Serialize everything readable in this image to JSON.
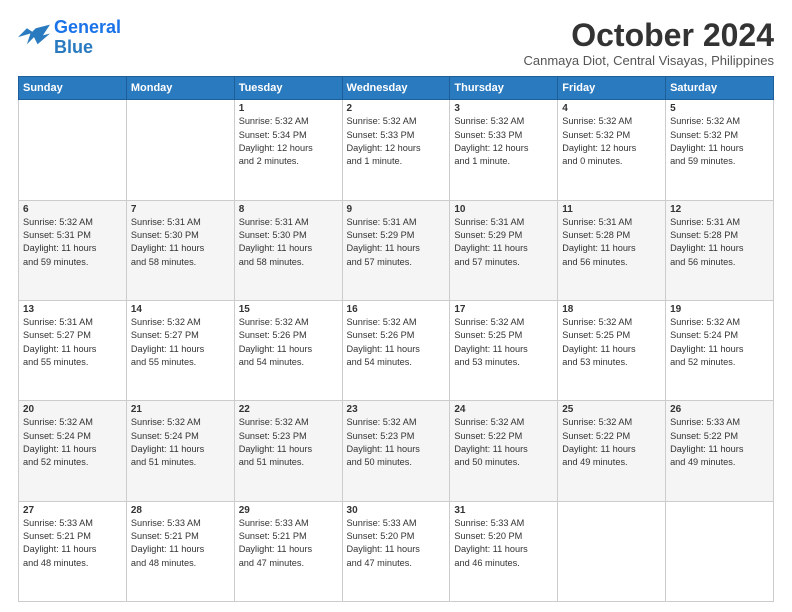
{
  "logo": {
    "line1": "General",
    "line2": "Blue"
  },
  "title": "October 2024",
  "subtitle": "Canmaya Diot, Central Visayas, Philippines",
  "headers": [
    "Sunday",
    "Monday",
    "Tuesday",
    "Wednesday",
    "Thursday",
    "Friday",
    "Saturday"
  ],
  "weeks": [
    [
      {
        "day": "",
        "info": ""
      },
      {
        "day": "",
        "info": ""
      },
      {
        "day": "1",
        "info": "Sunrise: 5:32 AM\nSunset: 5:34 PM\nDaylight: 12 hours\nand 2 minutes."
      },
      {
        "day": "2",
        "info": "Sunrise: 5:32 AM\nSunset: 5:33 PM\nDaylight: 12 hours\nand 1 minute."
      },
      {
        "day": "3",
        "info": "Sunrise: 5:32 AM\nSunset: 5:33 PM\nDaylight: 12 hours\nand 1 minute."
      },
      {
        "day": "4",
        "info": "Sunrise: 5:32 AM\nSunset: 5:32 PM\nDaylight: 12 hours\nand 0 minutes."
      },
      {
        "day": "5",
        "info": "Sunrise: 5:32 AM\nSunset: 5:32 PM\nDaylight: 11 hours\nand 59 minutes."
      }
    ],
    [
      {
        "day": "6",
        "info": "Sunrise: 5:32 AM\nSunset: 5:31 PM\nDaylight: 11 hours\nand 59 minutes."
      },
      {
        "day": "7",
        "info": "Sunrise: 5:31 AM\nSunset: 5:30 PM\nDaylight: 11 hours\nand 58 minutes."
      },
      {
        "day": "8",
        "info": "Sunrise: 5:31 AM\nSunset: 5:30 PM\nDaylight: 11 hours\nand 58 minutes."
      },
      {
        "day": "9",
        "info": "Sunrise: 5:31 AM\nSunset: 5:29 PM\nDaylight: 11 hours\nand 57 minutes."
      },
      {
        "day": "10",
        "info": "Sunrise: 5:31 AM\nSunset: 5:29 PM\nDaylight: 11 hours\nand 57 minutes."
      },
      {
        "day": "11",
        "info": "Sunrise: 5:31 AM\nSunset: 5:28 PM\nDaylight: 11 hours\nand 56 minutes."
      },
      {
        "day": "12",
        "info": "Sunrise: 5:31 AM\nSunset: 5:28 PM\nDaylight: 11 hours\nand 56 minutes."
      }
    ],
    [
      {
        "day": "13",
        "info": "Sunrise: 5:31 AM\nSunset: 5:27 PM\nDaylight: 11 hours\nand 55 minutes."
      },
      {
        "day": "14",
        "info": "Sunrise: 5:32 AM\nSunset: 5:27 PM\nDaylight: 11 hours\nand 55 minutes."
      },
      {
        "day": "15",
        "info": "Sunrise: 5:32 AM\nSunset: 5:26 PM\nDaylight: 11 hours\nand 54 minutes."
      },
      {
        "day": "16",
        "info": "Sunrise: 5:32 AM\nSunset: 5:26 PM\nDaylight: 11 hours\nand 54 minutes."
      },
      {
        "day": "17",
        "info": "Sunrise: 5:32 AM\nSunset: 5:25 PM\nDaylight: 11 hours\nand 53 minutes."
      },
      {
        "day": "18",
        "info": "Sunrise: 5:32 AM\nSunset: 5:25 PM\nDaylight: 11 hours\nand 53 minutes."
      },
      {
        "day": "19",
        "info": "Sunrise: 5:32 AM\nSunset: 5:24 PM\nDaylight: 11 hours\nand 52 minutes."
      }
    ],
    [
      {
        "day": "20",
        "info": "Sunrise: 5:32 AM\nSunset: 5:24 PM\nDaylight: 11 hours\nand 52 minutes."
      },
      {
        "day": "21",
        "info": "Sunrise: 5:32 AM\nSunset: 5:24 PM\nDaylight: 11 hours\nand 51 minutes."
      },
      {
        "day": "22",
        "info": "Sunrise: 5:32 AM\nSunset: 5:23 PM\nDaylight: 11 hours\nand 51 minutes."
      },
      {
        "day": "23",
        "info": "Sunrise: 5:32 AM\nSunset: 5:23 PM\nDaylight: 11 hours\nand 50 minutes."
      },
      {
        "day": "24",
        "info": "Sunrise: 5:32 AM\nSunset: 5:22 PM\nDaylight: 11 hours\nand 50 minutes."
      },
      {
        "day": "25",
        "info": "Sunrise: 5:32 AM\nSunset: 5:22 PM\nDaylight: 11 hours\nand 49 minutes."
      },
      {
        "day": "26",
        "info": "Sunrise: 5:33 AM\nSunset: 5:22 PM\nDaylight: 11 hours\nand 49 minutes."
      }
    ],
    [
      {
        "day": "27",
        "info": "Sunrise: 5:33 AM\nSunset: 5:21 PM\nDaylight: 11 hours\nand 48 minutes."
      },
      {
        "day": "28",
        "info": "Sunrise: 5:33 AM\nSunset: 5:21 PM\nDaylight: 11 hours\nand 48 minutes."
      },
      {
        "day": "29",
        "info": "Sunrise: 5:33 AM\nSunset: 5:21 PM\nDaylight: 11 hours\nand 47 minutes."
      },
      {
        "day": "30",
        "info": "Sunrise: 5:33 AM\nSunset: 5:20 PM\nDaylight: 11 hours\nand 47 minutes."
      },
      {
        "day": "31",
        "info": "Sunrise: 5:33 AM\nSunset: 5:20 PM\nDaylight: 11 hours\nand 46 minutes."
      },
      {
        "day": "",
        "info": ""
      },
      {
        "day": "",
        "info": ""
      }
    ]
  ]
}
